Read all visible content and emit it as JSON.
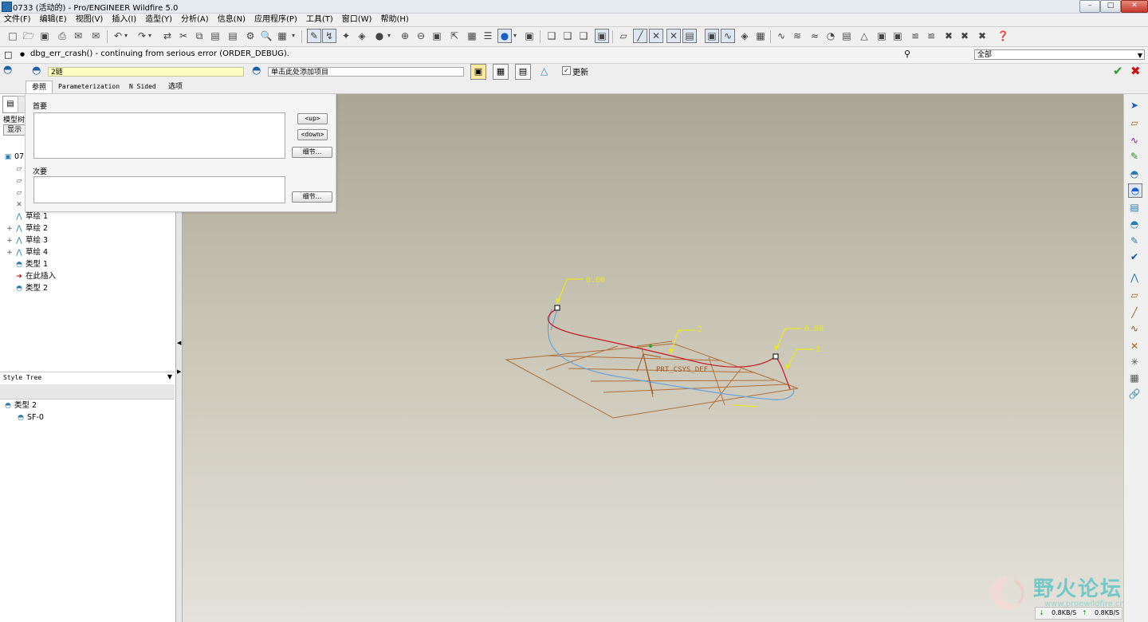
{
  "window": {
    "title": "0733 (活动的) - Pro/ENGINEER Wildfire 5.0",
    "buttons": [
      "–",
      "□",
      "✕"
    ]
  },
  "menu": [
    "文件(F)",
    "编辑(E)",
    "视图(V)",
    "插入(I)",
    "造型(Y)",
    "分析(A)",
    "信息(N)",
    "应用程序(P)",
    "工具(T)",
    "窗口(W)",
    "帮助(H)"
  ],
  "message": {
    "text": "dbg_err_crash() - continuing from serious error (ORDER_DEBUG).",
    "filter": "全部"
  },
  "dashboard": {
    "chain_label": "2链",
    "add_item": "单击此处添加项目",
    "update_label": "更新",
    "update_checked": true,
    "tabs": [
      "参照",
      "Parameterization",
      "N Sided",
      "选项"
    ],
    "active_tab": 0
  },
  "ref_panel": {
    "primary_label": "首要",
    "secondary_label": "次要",
    "up_button": "<up>",
    "down_button": "<down>",
    "detail_button": "细节..."
  },
  "model_tree": {
    "header": "模型树",
    "show_button": "显示",
    "root": "07",
    "items": [
      {
        "label": "草绘 1",
        "icon": "sketch-icon",
        "expand": ""
      },
      {
        "label": "草绘 2",
        "icon": "sketch-icon",
        "expand": "+"
      },
      {
        "label": "草绘 3",
        "icon": "sketch-icon",
        "expand": "+"
      },
      {
        "label": "草绘 4",
        "icon": "sketch-icon",
        "expand": "+"
      },
      {
        "label": "类型 1",
        "icon": "style-icon",
        "expand": ""
      },
      {
        "label": "在此插入",
        "icon": "insert-arrow-icon",
        "expand": ""
      },
      {
        "label": "类型 2",
        "icon": "style-icon",
        "expand": ""
      }
    ]
  },
  "style_tree": {
    "selector": "Style Tree",
    "root": "类型 2",
    "child": "SF-0"
  },
  "graphics": {
    "dims": [
      "0.00",
      "2",
      "0.00",
      "1"
    ],
    "csys": "PRT_CSYS_DEF"
  },
  "watermark": {
    "text": "野火论坛",
    "url": "www.proewildfire.cn"
  },
  "net_status": {
    "down": "0.8KB/S",
    "up": "0.8KB/S"
  },
  "colors": {
    "annotation": "#e8e81c",
    "curve_red": "#c8202a",
    "curve_blue": "#6ca6d8",
    "grid_brown": "#b0703a",
    "accept_green": "#2a9a2a",
    "cancel_red": "#cc1111"
  }
}
